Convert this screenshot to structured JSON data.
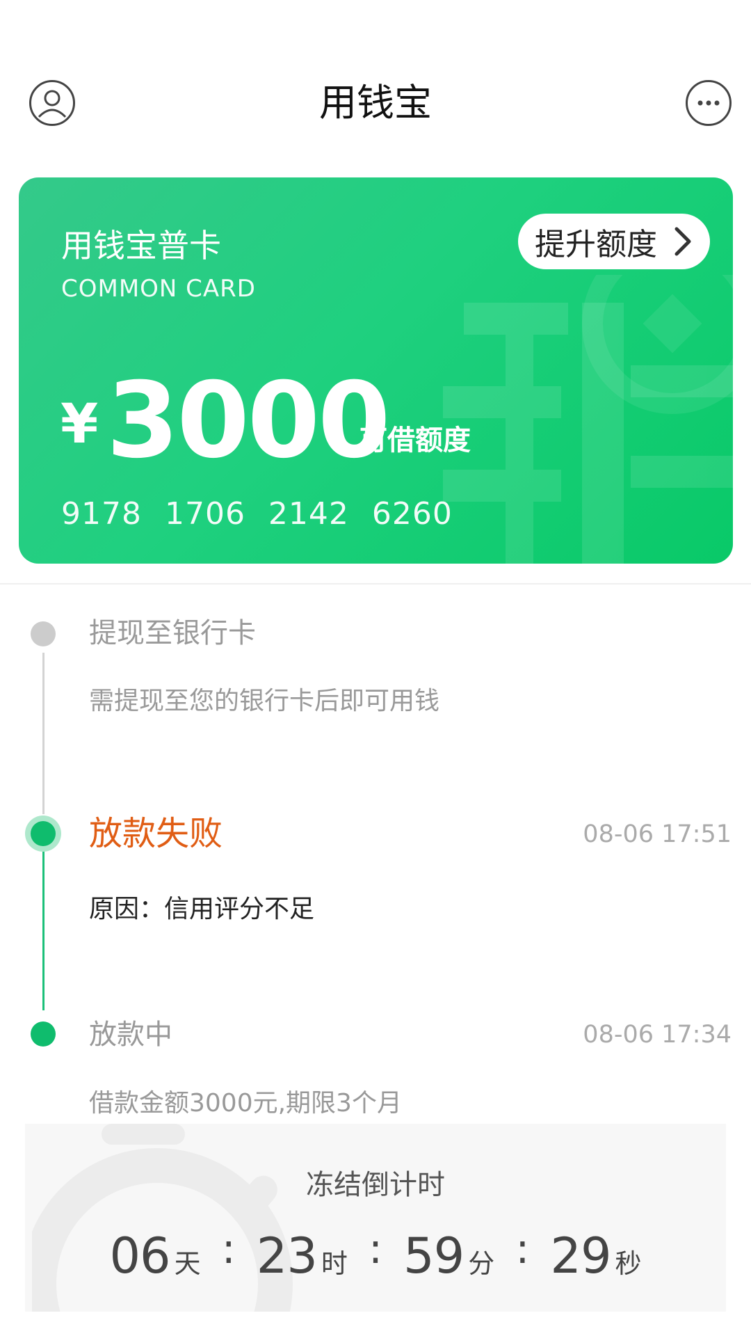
{
  "header": {
    "title": "用钱宝",
    "profile_icon": "user-profile-icon",
    "more_icon": "more-dots-icon"
  },
  "card": {
    "title": "用钱宝普卡",
    "subtitle": "COMMON CARD",
    "raise_button_label": "提升额度",
    "currency_symbol": "¥",
    "amount": "3000",
    "amount_label": "可借额度",
    "card_number": "9178 1706 2142 6260",
    "gradient_start": "#34c98a",
    "gradient_end": "#09c968"
  },
  "timeline": [
    {
      "title": "提现至银行卡",
      "description": "需提现至您的银行卡后即可用钱",
      "time": "",
      "status": "pending"
    },
    {
      "title": "放款失败",
      "description": "原因：信用评分不足",
      "time": "08-06 17:51",
      "status": "failed"
    },
    {
      "title": "放款中",
      "description": "借款金额3000元,期限3个月",
      "time": "08-06 17:34",
      "status": "done"
    }
  ],
  "countdown": {
    "title": "冻结倒计时",
    "days": "06",
    "days_unit": "天",
    "hours": "23",
    "hours_unit": "时",
    "minutes": "59",
    "minutes_unit": "分",
    "seconds": "29",
    "seconds_unit": "秒",
    "separator": ":"
  },
  "colors": {
    "accent_green": "#0fbc6d",
    "failure_orange": "#e05d14"
  }
}
